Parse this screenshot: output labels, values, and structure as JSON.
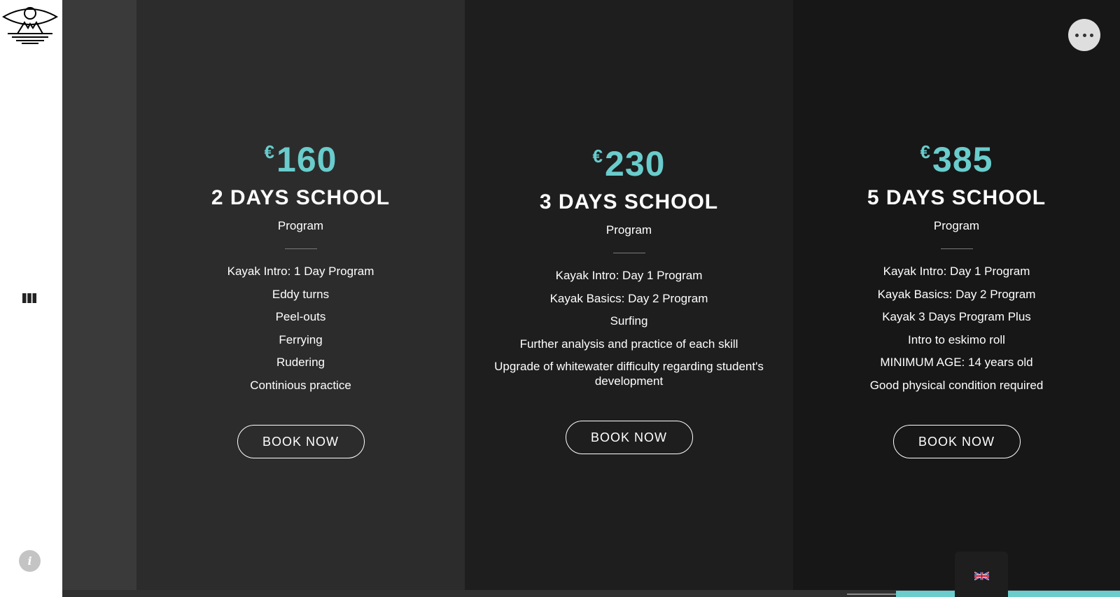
{
  "sidebar": {
    "logo_icon": "sun-mountain-water-logo",
    "menu_icon": "columns-menu-icon",
    "info_icon": "info-icon",
    "info_label": "i"
  },
  "colors": {
    "accent": "#6acccc",
    "sidebar_bg": "#ffffff",
    "column_1_bg": "#2c2c2c",
    "column_2_bg": "#1e1e1e",
    "column_3_bg": "#171717"
  },
  "plans": [
    {
      "currency": "€",
      "price": "160",
      "title": "2 DAYS SCHOOL",
      "subtitle": "Program",
      "features": [
        "Kayak Intro: 1 Day Program",
        "Eddy turns",
        "Peel-outs",
        "Ferrying",
        "Rudering",
        "Continious practice"
      ],
      "button": "BOOK NOW"
    },
    {
      "currency": "€",
      "price": "230",
      "title": "3 DAYS SCHOOL",
      "subtitle": "Program",
      "features": [
        "Kayak Intro: Day 1 Program",
        "Kayak Basics: Day 2 Program",
        "Surfing",
        "Further analysis and practice of each skill",
        "Upgrade of whitewater difficulty regarding student's development"
      ],
      "button": "BOOK NOW"
    },
    {
      "currency": "€",
      "price": "385",
      "title": "5 DAYS SCHOOL",
      "subtitle": "Program",
      "features": [
        "Kayak Intro: Day 1 Program",
        "Kayak Basics: Day 2 Program",
        "Kayak 3 Days Program Plus",
        "Intro to eskimo roll",
        "MINIMUM AGE: 14 years old",
        "Good physical condition required"
      ],
      "button": "BOOK NOW"
    }
  ],
  "more_button": {
    "icon": "more-dots-icon"
  },
  "language": {
    "icon": "uk-flag-icon"
  }
}
